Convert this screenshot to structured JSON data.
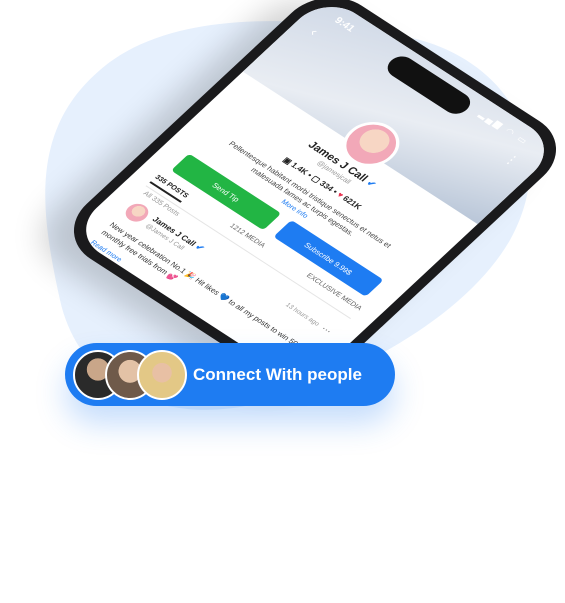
{
  "status": {
    "time": "9:41"
  },
  "profile": {
    "name": "James J Call",
    "handle": "@jamesjcall",
    "stats": {
      "photos": "1.4K",
      "videos": "334",
      "likes": "621K"
    },
    "bio": "Pellentesque habitant morbi tristique senectus et netus et malesuada fames ac turpis egestas.",
    "more_info": "More info",
    "send_tip_label": "Send Tip",
    "subscribe_label": "Subscribe 9.99$"
  },
  "tabs": [
    {
      "label": "335 POSTS",
      "active": true
    },
    {
      "label": "1212 MEDIA",
      "active": false
    },
    {
      "label": "EXCLUSIVE MEDIA",
      "active": false
    }
  ],
  "subtab": "All 335 Posts",
  "post": {
    "author": "James J Call",
    "handle": "@James J Call",
    "time": "13 hours ago",
    "text": "New year celebration No.1 🎉 Hit likes 💙 to all my posts to win 50 monthly free trials from 💕",
    "read_more": "Read more"
  },
  "connect": {
    "label": "Connect With people"
  },
  "colors": {
    "accent": "#1e7cf2",
    "tip": "#22b544",
    "blob": "#e6f0fd"
  }
}
